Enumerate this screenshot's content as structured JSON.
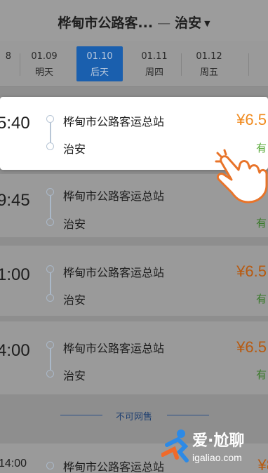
{
  "header": {
    "origin": "桦甸市公路客...",
    "separator": "—",
    "destination": "治安",
    "dropdown_icon": "caret-down-icon"
  },
  "dates": [
    {
      "date": "8",
      "weekday": ""
    },
    {
      "date": "01.09",
      "weekday": "明天"
    },
    {
      "date": "01.10",
      "weekday": "后天",
      "selected": true
    },
    {
      "date": "01.11",
      "weekday": "周四"
    },
    {
      "date": "01.12",
      "weekday": "周五"
    }
  ],
  "trips": [
    {
      "time": "5:40",
      "from": "桦甸市公路客运总站",
      "to": "治安",
      "price": "¥6.5",
      "seats": "有",
      "highlighted": true
    },
    {
      "time": "9:45",
      "from": "桦甸市公路客运总站",
      "to": "治安",
      "price": "",
      "seats": "有"
    },
    {
      "time": "1:00",
      "from": "桦甸市公路客运总站",
      "to": "治安",
      "price": "¥6.5",
      "seats": "有"
    },
    {
      "time": "4:00",
      "from": "桦甸市公路客运总站",
      "to": "治安",
      "price": "¥6.5",
      "seats": "有"
    },
    {
      "time": "14:00",
      "from": "桦甸市公路客运总站",
      "to": "",
      "price": "¥8",
      "seats": ""
    }
  ],
  "no_sale_label": "不可网售",
  "watermark": {
    "title": "爱·尬聊",
    "url": "igaliao.com"
  },
  "colors": {
    "accent": "#1a5fae",
    "price": "#f08a1e",
    "seats": "#5aaa3a",
    "overlay": "#8e8e8e"
  }
}
